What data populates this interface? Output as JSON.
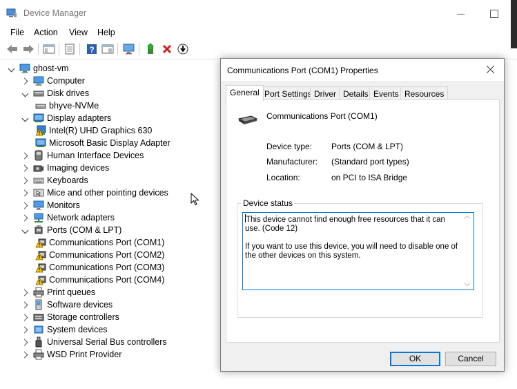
{
  "window": {
    "title": "Device Manager"
  },
  "menu": [
    "File",
    "Action",
    "View",
    "Help"
  ],
  "toolbar": {
    "buttons": [
      "back-icon",
      "forward-icon",
      "show-hide-console-tree-icon",
      "properties-icon",
      "help-icon",
      "action-pane-icon",
      "scan-hardware-icon",
      "update-driver-icon",
      "uninstall-icon",
      "disable-icon"
    ]
  },
  "tree": {
    "root": "ghost-vm",
    "items": [
      {
        "label": "Computer",
        "state": "closed",
        "icon": "computer-icon"
      },
      {
        "label": "Disk drives",
        "state": "open",
        "icon": "disk-drive-icon"
      },
      {
        "label": "bhyve-NVMe",
        "child": true,
        "icon": "disk-icon"
      },
      {
        "label": "Display adapters",
        "state": "open",
        "icon": "display-adapter-icon"
      },
      {
        "label": "Intel(R) UHD Graphics 630",
        "child": true,
        "icon": "warning-display-icon"
      },
      {
        "label": "Microsoft Basic Display Adapter",
        "child": true,
        "icon": "display-adapter-icon"
      },
      {
        "label": "Human Interface Devices",
        "state": "closed",
        "icon": "hid-icon"
      },
      {
        "label": "Imaging devices",
        "state": "closed",
        "icon": "camera-icon"
      },
      {
        "label": "Keyboards",
        "state": "closed",
        "icon": "keyboard-icon"
      },
      {
        "label": "Mice and other pointing devices",
        "state": "closed",
        "icon": "mouse-icon"
      },
      {
        "label": "Monitors",
        "state": "closed",
        "icon": "monitor-icon"
      },
      {
        "label": "Network adapters",
        "state": "closed",
        "icon": "network-icon"
      },
      {
        "label": "Ports (COM & LPT)",
        "state": "open",
        "icon": "port-icon"
      },
      {
        "label": "Communications Port (COM1)",
        "child": true,
        "icon": "warning-port-icon"
      },
      {
        "label": "Communications Port (COM2)",
        "child": true,
        "icon": "warning-port-icon"
      },
      {
        "label": "Communications Port (COM3)",
        "child": true,
        "icon": "warning-port-icon"
      },
      {
        "label": "Communications Port (COM4)",
        "child": true,
        "icon": "warning-port-icon"
      },
      {
        "label": "Print queues",
        "state": "closed",
        "icon": "printer-icon"
      },
      {
        "label": "Software devices",
        "state": "closed",
        "icon": "software-icon"
      },
      {
        "label": "Storage controllers",
        "state": "closed",
        "icon": "storage-icon"
      },
      {
        "label": "System devices",
        "state": "closed",
        "icon": "system-icon"
      },
      {
        "label": "Universal Serial Bus controllers",
        "state": "closed",
        "icon": "usb-icon"
      },
      {
        "label": "WSD Print Provider",
        "state": "closed",
        "icon": "printer-icon"
      }
    ]
  },
  "dialog": {
    "title": "Communications Port (COM1) Properties",
    "tabs": [
      "General",
      "Port Settings",
      "Driver",
      "Details",
      "Events",
      "Resources"
    ],
    "active_tab": "General",
    "device_name": "Communications Port (COM1)",
    "props": [
      {
        "label": "Device type:",
        "value": "Ports (COM & LPT)"
      },
      {
        "label": "Manufacturer:",
        "value": "(Standard port types)"
      },
      {
        "label": "Location:",
        "value": "on PCI to ISA Bridge"
      }
    ],
    "status_legend": "Device status",
    "status_line1": "This device cannot find enough free resources that it can use. (Code 12)",
    "status_line2": "If you want to use this device, you will need to disable one of the other devices on this system.",
    "ok_label": "OK",
    "cancel_label": "Cancel"
  },
  "colors": {
    "accent": "#0078d7",
    "warning": "#f5c400"
  }
}
